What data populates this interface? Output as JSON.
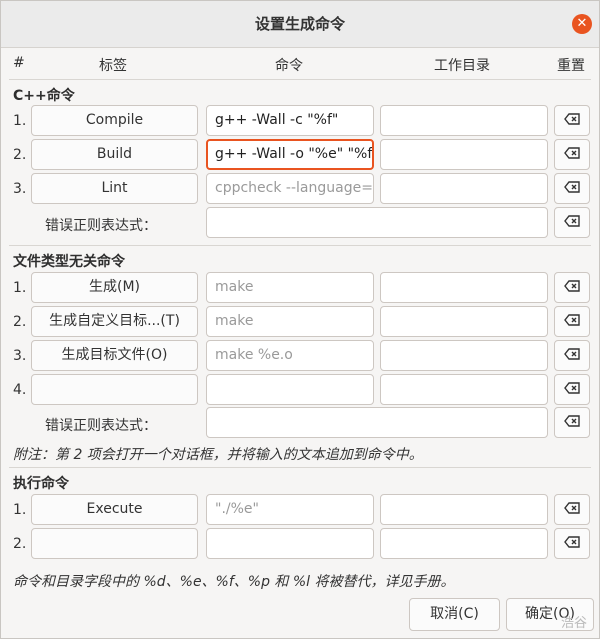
{
  "window": {
    "title": "设置生成命令"
  },
  "headers": {
    "num": "#",
    "label": "标签",
    "command": "命令",
    "workdir": "工作目录",
    "reset": "重置"
  },
  "cpp": {
    "title": "C++命令",
    "rows": [
      {
        "n": "1.",
        "label": "Compile",
        "command": "g++ -Wall -c \"%f\"",
        "placeholder": "",
        "workdir": ""
      },
      {
        "n": "2.",
        "label": "Build",
        "command": "g++ -Wall -o \"%e\" \"%f\"",
        "placeholder": "",
        "workdir": ""
      },
      {
        "n": "3.",
        "label": "Lint",
        "command": "",
        "placeholder": "cppcheck --language=c",
        "workdir": ""
      }
    ],
    "error_regex_label": "错误正则表达式：",
    "error_regex": ""
  },
  "independent": {
    "title": "文件类型无关命令",
    "rows": [
      {
        "n": "1.",
        "label": "生成(M)",
        "command": "",
        "placeholder": "make",
        "workdir": ""
      },
      {
        "n": "2.",
        "label": "生成自定义目标...(T)",
        "command": "",
        "placeholder": "make",
        "workdir": ""
      },
      {
        "n": "3.",
        "label": "生成目标文件(O)",
        "command": "",
        "placeholder": "make %e.o",
        "workdir": ""
      },
      {
        "n": "4.",
        "label": "",
        "command": "",
        "placeholder": "",
        "workdir": ""
      }
    ],
    "error_regex_label": "错误正则表达式：",
    "error_regex": ""
  },
  "note": "附注：第 2 项会打开一个对话框，并将输入的文本追加到命令中。",
  "execute": {
    "title": "执行命令",
    "rows": [
      {
        "n": "1.",
        "label": "Execute",
        "command": "",
        "placeholder": "\"./%e\"",
        "workdir": ""
      },
      {
        "n": "2.",
        "label": "",
        "command": "",
        "placeholder": "",
        "workdir": ""
      }
    ]
  },
  "footer_note": "命令和目录字段中的 %d、%e、%f、%p 和 %l 将被替代，详见手册。",
  "buttons": {
    "cancel": "取消(C)",
    "ok": "确定(O)"
  },
  "watermark": "浩谷",
  "icons": {
    "close": "close-icon",
    "reset": "clear-icon"
  },
  "colors": {
    "accent": "#e95420"
  }
}
